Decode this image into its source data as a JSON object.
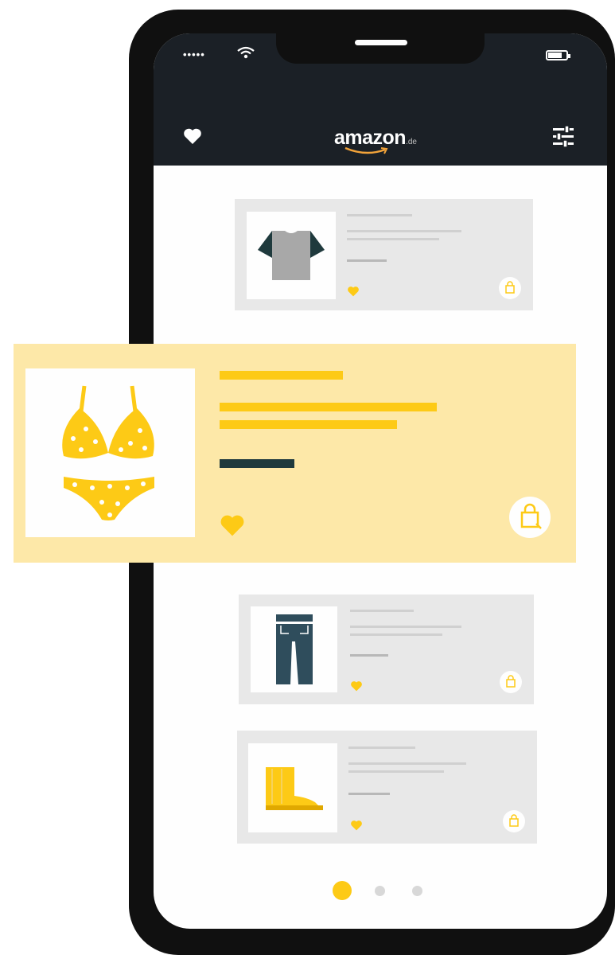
{
  "status_bar": {
    "signal_dots": "•••••",
    "wifi_icon": "wifi-icon",
    "battery_icon": "battery-icon"
  },
  "header": {
    "logo_text": "amazon",
    "logo_tld": ".de",
    "wishlist_icon": "heart-icon",
    "filter_icon": "sliders-icon"
  },
  "products": [
    {
      "item": "t-shirt",
      "favorite_icon": "heart-icon",
      "cart_icon": "shopping-bag-icon"
    },
    {
      "item": "bikini",
      "favorite_icon": "heart-icon",
      "cart_icon": "shopping-bag-icon",
      "highlighted": true
    },
    {
      "item": "jeans",
      "favorite_icon": "heart-icon",
      "cart_icon": "shopping-bag-icon"
    },
    {
      "item": "boot",
      "favorite_icon": "heart-icon",
      "cart_icon": "shopping-bag-icon"
    }
  ],
  "pagination": {
    "pages": 3,
    "active": 1
  },
  "colors": {
    "header_bg": "#1b2026",
    "accent_yellow": "#fdca16",
    "highlight_bg": "#fde8a8",
    "card_bg": "#e8e8e8",
    "dark_bar": "#1f3a3d",
    "denim": "#2f4d5c"
  }
}
